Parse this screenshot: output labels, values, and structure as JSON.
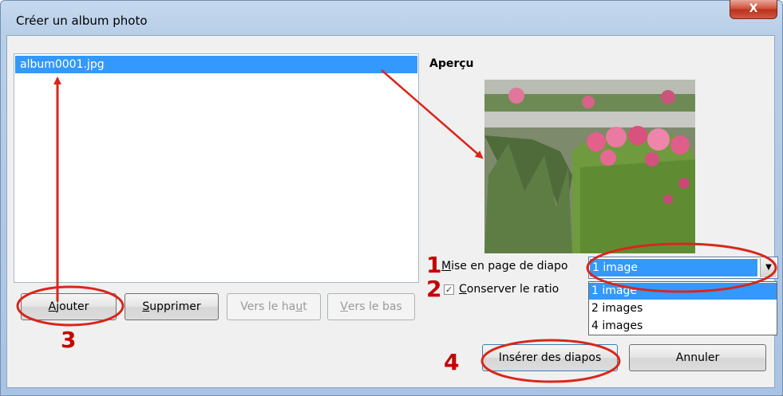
{
  "window": {
    "title": "Créer un album photo",
    "close_label": "X"
  },
  "list": {
    "items": [
      "album0001.jpg"
    ]
  },
  "buttons": {
    "add": {
      "label_underlined": "A",
      "label_rest": "jouter"
    },
    "remove": {
      "label_underlined": "S",
      "label_rest": "upprimer"
    },
    "move_up": {
      "label_pre": "Vers le ha",
      "label_underlined": "u",
      "label_post": "t"
    },
    "move_down": {
      "label_underlined": "V",
      "label_rest": "ers le bas"
    },
    "insert": {
      "label": "Insérer des diapos"
    },
    "cancel": {
      "label": "Annuler"
    }
  },
  "preview": {
    "heading": "Aperçu"
  },
  "layout_field": {
    "label_underlined": "M",
    "label_rest": "ise en page de diapo",
    "selected": "1 image",
    "options": [
      "1 image",
      "2 images",
      "4 images"
    ]
  },
  "keep_ratio": {
    "label_underlined": "C",
    "label_rest": "onserver le ratio",
    "checked": true,
    "check_glyph": "✓"
  },
  "annotations": {
    "n1": "1",
    "n2": "2",
    "n3": "3",
    "n4": "4"
  },
  "colors": {
    "annotation_red": "#d9261c",
    "selection_blue": "#3399ff"
  }
}
